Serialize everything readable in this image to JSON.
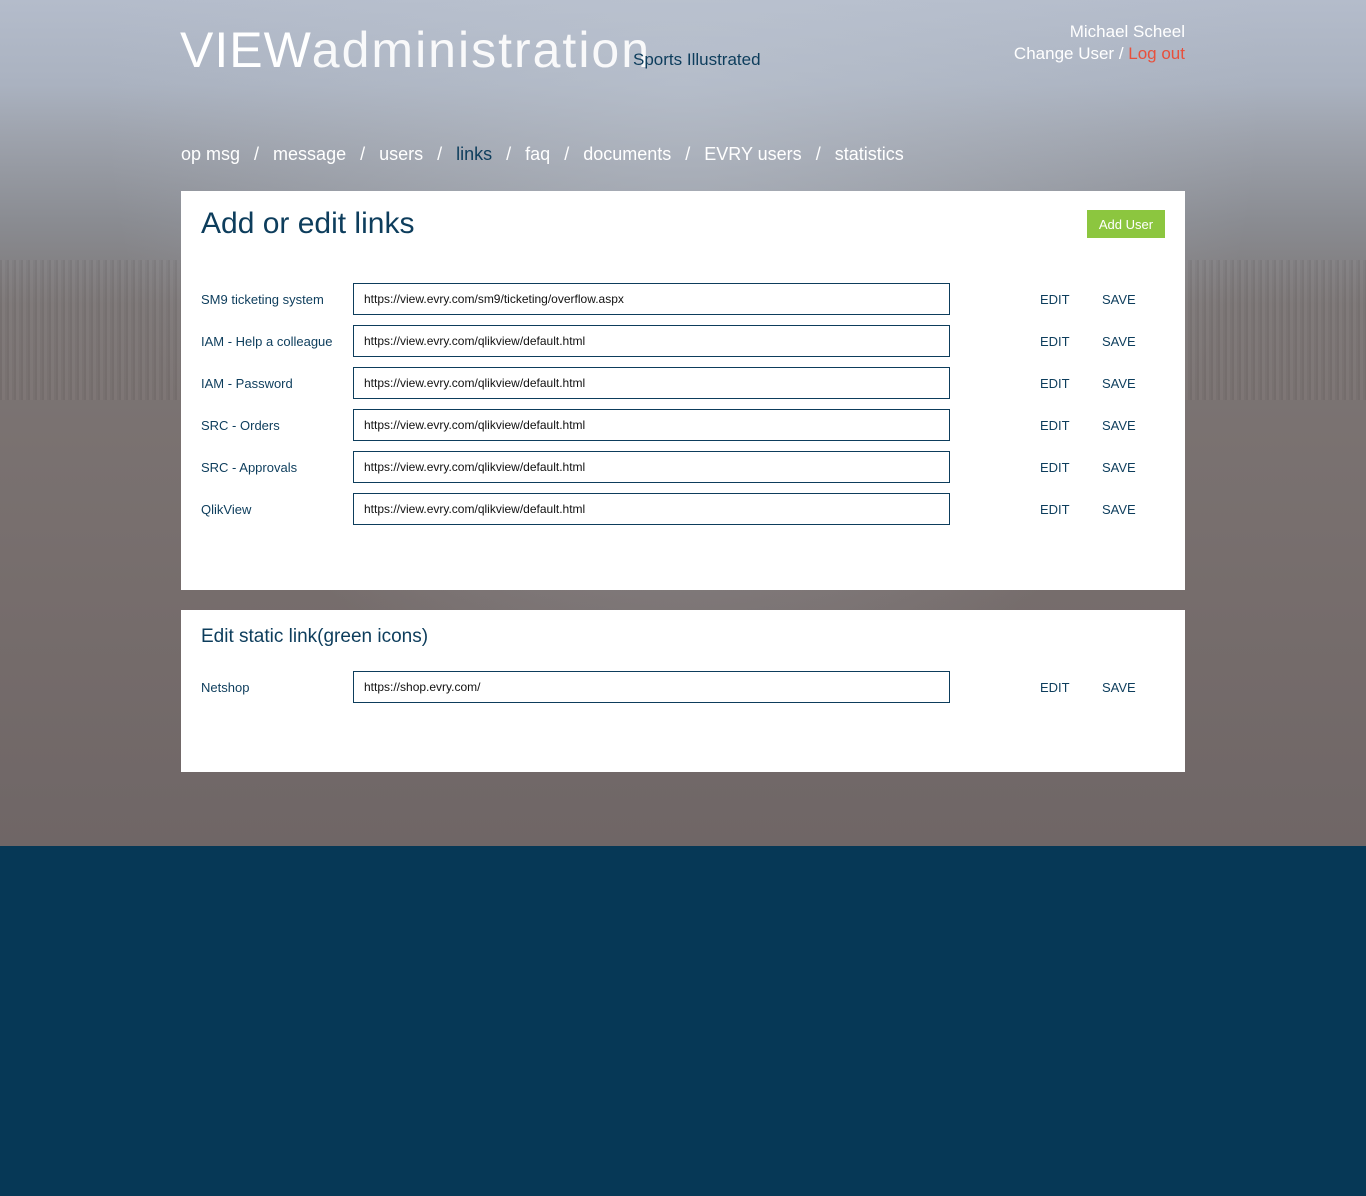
{
  "header": {
    "logo_bold": "VIEW",
    "logo_light": "administration",
    "organization": "Sports Illustrated",
    "user_name": "Michael Scheel",
    "change_user": "Change User",
    "separator": " / ",
    "logout": "Log out"
  },
  "nav": {
    "items": [
      {
        "label": "op msg",
        "active": false
      },
      {
        "label": "message",
        "active": false
      },
      {
        "label": "users",
        "active": false
      },
      {
        "label": "links",
        "active": true
      },
      {
        "label": "faq",
        "active": false
      },
      {
        "label": "documents",
        "active": false
      },
      {
        "label": "EVRY users",
        "active": false
      },
      {
        "label": "statistics",
        "active": false
      }
    ],
    "separator": "/"
  },
  "links_panel": {
    "title": "Add or edit links",
    "add_button": "Add User",
    "edit_label": "EDIT",
    "save_label": "SAVE",
    "rows": [
      {
        "label": "SM9 ticketing system",
        "url": "https://view.evry.com/sm9/ticketing/overflow.aspx"
      },
      {
        "label": "IAM - Help a colleague",
        "url": "https://view.evry.com/qlikview/default.html"
      },
      {
        "label": "IAM - Password",
        "url": "https://view.evry.com/qlikview/default.html"
      },
      {
        "label": "SRC - Orders",
        "url": "https://view.evry.com/qlikview/default.html"
      },
      {
        "label": "SRC - Approvals",
        "url": "https://view.evry.com/qlikview/default.html"
      },
      {
        "label": "QlikView",
        "url": "https://view.evry.com/qlikview/default.html"
      }
    ]
  },
  "static_panel": {
    "title": "Edit static link(green icons)",
    "edit_label": "EDIT",
    "save_label": "SAVE",
    "rows": [
      {
        "label": "Netshop",
        "url": "https://shop.evry.com/"
      }
    ]
  },
  "colors": {
    "primary": "#0d3d5c",
    "accent_green": "#8cc63f",
    "logout_red": "#e8503c",
    "footer": "#063856"
  }
}
